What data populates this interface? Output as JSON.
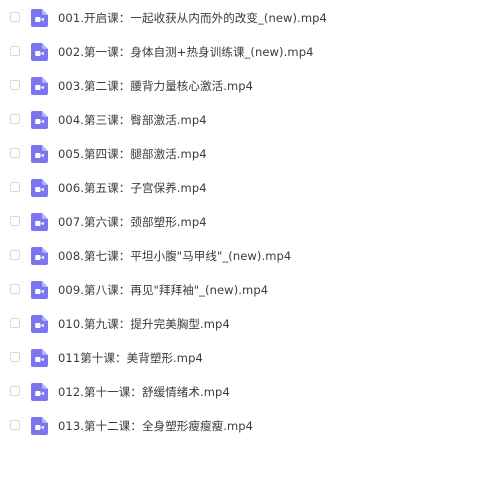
{
  "colors": {
    "icon_bg": "#7b75f0",
    "icon_fold": "#b6b2f8",
    "icon_glyph": "#ffffff",
    "text": "#3b3b3b",
    "checkbox_border": "#d6d9de"
  },
  "icons": {
    "file": "video-file-icon"
  },
  "files": [
    {
      "name": "001.开启课：一起收获从内而外的改变_(new).mp4"
    },
    {
      "name": "002.第一课：身体自测+热身训练课_(new).mp4"
    },
    {
      "name": "003.第二课：腰背力量核心激活.mp4"
    },
    {
      "name": "004.第三课：臀部激活.mp4"
    },
    {
      "name": "005.第四课：腿部激活.mp4"
    },
    {
      "name": "006.第五课：子宫保养.mp4"
    },
    {
      "name": "007.第六课：颈部塑形.mp4"
    },
    {
      "name": "008.第七课：平坦小腹\"马甲线\"_(new).mp4"
    },
    {
      "name": "009.第八课：再见\"拜拜袖\"_(new).mp4"
    },
    {
      "name": "010.第九课：提升完美胸型.mp4"
    },
    {
      "name": "011第十课：美背塑形.mp4"
    },
    {
      "name": "012.第十一课：舒缓情绪术.mp4"
    },
    {
      "name": "013.第十二课：全身塑形瘦瘦瘦.mp4"
    }
  ]
}
